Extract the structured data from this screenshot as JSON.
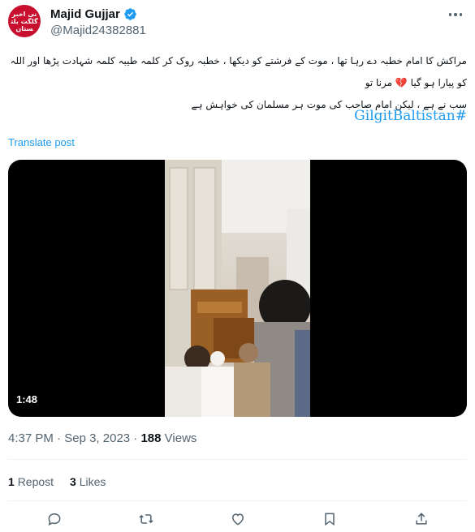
{
  "author": {
    "display_name": "Majid Gujjar",
    "handle": "@Majid24382881",
    "avatar_text": "نی اخبر گلگت بلتستان"
  },
  "post": {
    "text_line1": "مراکش کا امام خطبہ دے رہا تھا ، موت کے فرشتے کو دیکھا ، خطبہ روک کر کلمہ طیبہ کلمہ شہادت پڑھا اور اللہ کو پیارا ہو گیا 💔 مرنا تو",
    "text_line2": "سب نے ہے ، لیکن امام صاحب کی موت ہر مسلمان کی خواہش ہے",
    "hashtag": "GilgitBaltistan#",
    "translate_label": "Translate post"
  },
  "video": {
    "duration": "1:48"
  },
  "meta": {
    "time": "4:37 PM",
    "date": "Sep 3, 2023",
    "views_count": "188",
    "views_label": "Views"
  },
  "stats": {
    "reposts_count": "1",
    "reposts_label": "Repost",
    "likes_count": "3",
    "likes_label": "Likes"
  },
  "colors": {
    "accent": "#1d9bf0",
    "secondary_text": "#536471",
    "divider": "#eff3f4"
  }
}
